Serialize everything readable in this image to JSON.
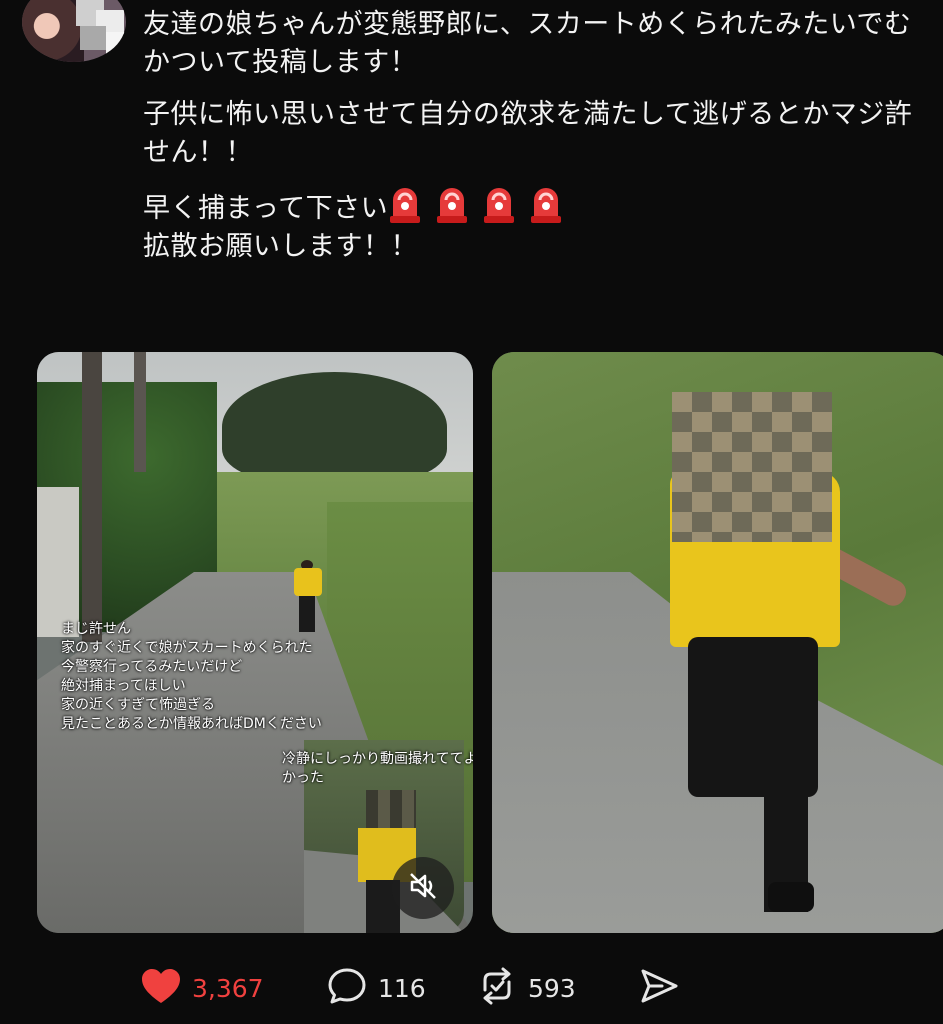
{
  "post": {
    "paragraphs": [
      "友達の娘ちゃんが変態野郎に、スカートめくられたみたいでむかついて投稿します！",
      "子供に怖い思いさせて自分の欲求を満たして逃げるとかマジ許せん！！",
      "早く捕まって下さい"
    ],
    "last_line": "拡散お願いします！！",
    "siren_icons": [
      "police-light-icon",
      "police-light-icon",
      "police-light-icon",
      "police-light-icon"
    ]
  },
  "media": {
    "image1": {
      "overlay_lines": [
        "まじ許せん",
        "家のすぐ近くで娘がスカートめくられた",
        "今警察行ってるみたいだけど",
        "絶対捕まってほしい",
        "家の近くすぎて怖過ぎる",
        "見たことあるとか情報あればDMください"
      ],
      "inset_caption": "冷静にしっかり動画撮れててよかった"
    }
  },
  "actions": {
    "likes": "3,367",
    "replies": "116",
    "reposts": "593"
  },
  "colors": {
    "background": "#0b0b0b",
    "like_red": "#f0413f",
    "text": "#f3f3f3"
  }
}
